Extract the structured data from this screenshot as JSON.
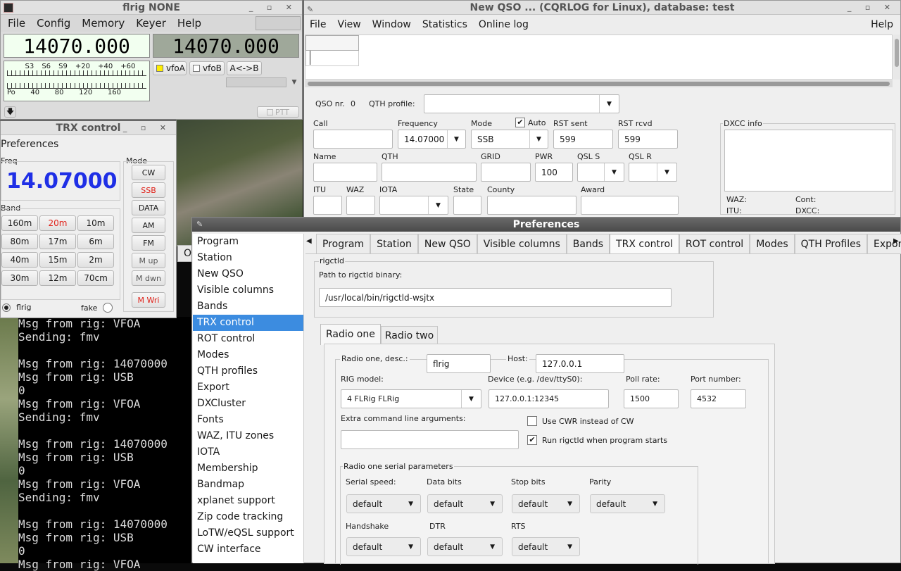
{
  "flrig": {
    "title": "flrig NONE",
    "menu": [
      "File",
      "Config",
      "Memory",
      "Keyer",
      "Help"
    ],
    "freq_a": "14070.000",
    "freq_b": "14070.000",
    "s_scale": [
      "S3",
      "S6",
      "S9",
      "+20",
      "+40",
      "+60"
    ],
    "po_scale": [
      "Po",
      "40",
      "80",
      "120",
      "160"
    ],
    "vfoa": "vfoA",
    "vfob": "vfoB",
    "swap": "A<->B",
    "ptt": "PTT"
  },
  "trx": {
    "title": "TRX control",
    "preferences": "Preferences",
    "freq_label": "Freq",
    "freq": "14.07000",
    "band_label": "Band",
    "mode_label": "Mode",
    "bands": [
      "160m",
      "20m",
      "10m",
      "80m",
      "17m",
      "6m",
      "40m",
      "15m",
      "2m",
      "30m",
      "12m",
      "70cm"
    ],
    "modes": [
      "CW",
      "SSB",
      "DATA",
      "AM",
      "FM",
      "M up",
      "M dwn",
      "M Wri"
    ],
    "radio_flrig": "flrig",
    "radio_fake": "fake"
  },
  "terminal": {
    "lines": [
      "Msg from rig: VFOA",
      "Sending: fmv",
      "",
      "Msg from rig: 14070000",
      "Msg from rig: USB",
      "0",
      "Msg from rig: VFOA",
      "Sending: fmv",
      "",
      "Msg from rig: 14070000",
      "Msg from rig: USB",
      "0",
      "Msg from rig: VFOA",
      "Sending: fmv",
      "",
      "Msg from rig: 14070000",
      "Msg from rig: USB",
      "0",
      "Msg from rig: VFOA"
    ]
  },
  "qso": {
    "title": "New QSO ... (CQRLOG for Linux), database: test",
    "menu": [
      "File",
      "View",
      "Window",
      "Statistics",
      "Online log"
    ],
    "help": "Help",
    "qso_nr_label": "QSO nr.",
    "qso_nr": "0",
    "qth_profile_label": "QTH profile:",
    "call_label": "Call",
    "frequency_label": "Frequency",
    "frequency": "14.07000",
    "mode_label": "Mode",
    "mode": "SSB",
    "auto_label": "Auto",
    "rst_sent_label": "RST sent",
    "rst_sent": "599",
    "rst_rcvd_label": "RST rcvd",
    "rst_rcvd": "599",
    "name_label": "Name",
    "qth_label": "QTH",
    "grid_label": "GRID",
    "pwr_label": "PWR",
    "pwr": "100",
    "qsl_s_label": "QSL  S",
    "qsl_r_label": "QSL  R",
    "itu_label": "ITU",
    "waz_label": "WAZ",
    "iota_label": "IOTA",
    "state_label": "State",
    "county_label": "County",
    "award_label": "Award",
    "dxcc_info": "DXCC info",
    "waz": "WAZ:",
    "itu": "ITU:",
    "cont": "Cont:",
    "dxcc": "DXCC:"
  },
  "prefs": {
    "title": "Preferences",
    "sidebar": [
      "Program",
      "Station",
      "New QSO",
      "Visible columns",
      "Bands",
      "TRX control",
      "ROT control",
      "Modes",
      "QTH profiles",
      "Export",
      "DXCluster",
      "Fonts",
      "WAZ, ITU zones",
      "IOTA",
      "Membership",
      "Bandmap",
      "xplanet support",
      "Zip code tracking",
      "LoTW/eQSL support",
      "CW interface"
    ],
    "tabs": [
      "Program",
      "Station",
      "New QSO",
      "Visible columns",
      "Bands",
      "TRX control",
      "ROT control",
      "Modes",
      "QTH Profiles",
      "Export"
    ],
    "rigctld_group": "rigctld",
    "path_label": "Path to rigctld binary:",
    "path": "/usr/local/bin/rigctld-wsjtx",
    "radio_tabs": [
      "Radio one",
      "Radio two"
    ],
    "desc_label": "Radio one, desc.:",
    "desc": "flrig",
    "host_label": "Host:",
    "host": "127.0.0.1",
    "rig_model_label": "RIG model:",
    "rig_model": "4 FLRig FLRig",
    "device_label": "Device (e.g. /dev/ttyS0):",
    "device": "127.0.0.1:12345",
    "poll_label": "Poll rate:",
    "poll": "1500",
    "port_label": "Port number:",
    "port": "4532",
    "extra_label": "Extra command line arguments:",
    "cwr_label": "Use CWR instead of CW",
    "run_label": "Run rigctld when program starts",
    "serial_group": "Radio one serial parameters",
    "serial_speed_label": "Serial speed:",
    "data_bits_label": "Data bits",
    "stop_bits_label": "Stop bits",
    "parity_label": "Parity",
    "handshake_label": "Handshake",
    "dtr_label": "DTR",
    "rts_label": "RTS",
    "default": "default"
  },
  "colors": {
    "accent": "#3c8ce0",
    "freq_blue": "#1f2fe6",
    "red_text": "#e0221a",
    "flrig_display": "#f2fff0"
  }
}
